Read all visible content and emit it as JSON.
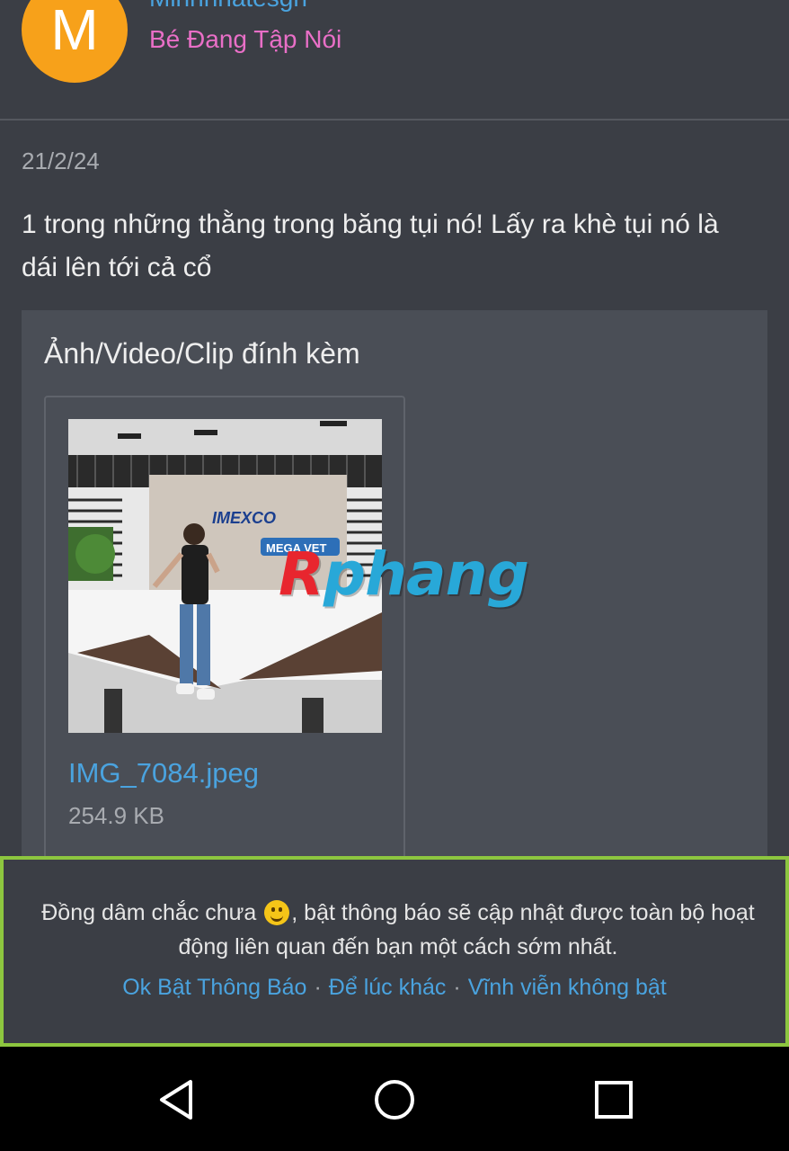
{
  "header": {
    "avatar_letter": "M",
    "avatar_color": "#f7a11a",
    "username": "Minhnhatesgn",
    "user_title": "Bé Đang Tập Nói"
  },
  "post": {
    "date": "21/2/24",
    "body": "1 trong những thằng trong băng tụi nó! Lấy ra khè tụi nó là dái lên tới cả cổ"
  },
  "attachments": {
    "title": "Ảnh/Video/Clip đính kèm",
    "files": [
      {
        "name": "IMG_7084.jpeg",
        "size": "254.9 KB",
        "image_signs": [
          "IMEXCO",
          "MEGA VET"
        ]
      }
    ]
  },
  "watermark": {
    "first_letter": "R",
    "rest": "phang"
  },
  "notice": {
    "text_before": "Đồng dâm chắc chưa",
    "emoji": "smiley-icon",
    "text_after": ", bật thông báo sẽ cập nhật được toàn bộ hoạt động liên quan đến bạn một cách sớm nhất.",
    "actions": [
      "Ok Bật Thông Báo",
      "Để lúc khác",
      "Vĩnh viễn không bật"
    ],
    "separator": "·",
    "border_color": "#8dc63f"
  },
  "navbar": {
    "buttons": [
      "back-icon",
      "home-icon",
      "recent-apps-icon"
    ]
  },
  "colors": {
    "background": "#3b3e45",
    "link": "#4aa3df",
    "user_title": "#e96fc7"
  }
}
